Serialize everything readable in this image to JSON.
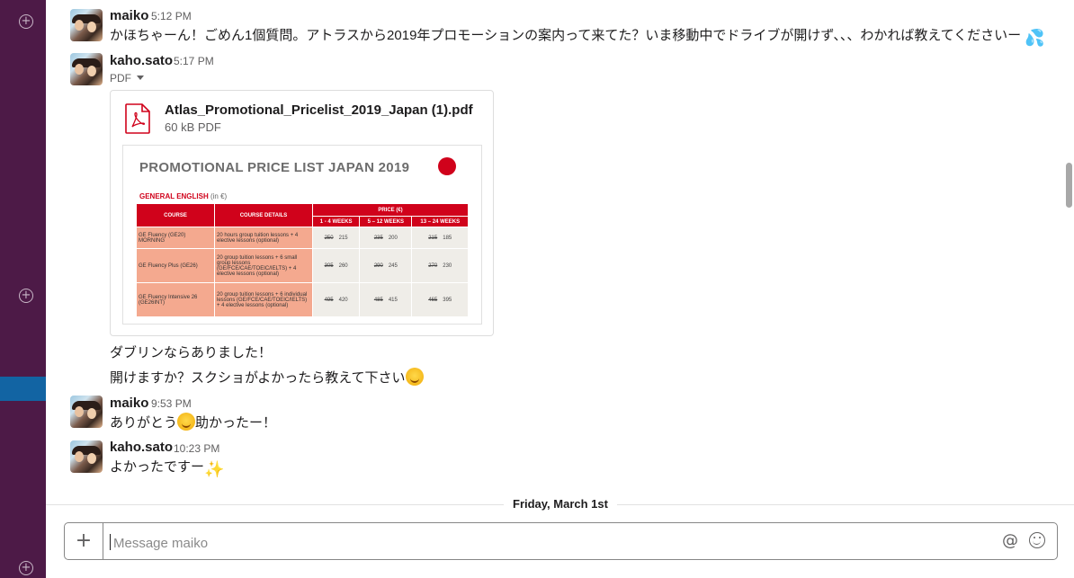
{
  "messages": [
    {
      "author": "maiko",
      "time": "5:12 PM",
      "text": "かほちゃーん！ごめん1個質問。アトラスから2019年プロモーションの案内って来てた？いま移動中でドライブが開けず、、、わかれば教えてくださいー"
    },
    {
      "author": "kaho.sato",
      "time": "5:17 PM",
      "attachment_type": "PDF",
      "file": {
        "name": "Atlas_Promotional_Pricelist_2019_Japan (1).pdf",
        "meta": "60 kB PDF"
      },
      "followups": [
        "ダブリンならありました！",
        "開けますか？スクショがよかったら教えて下さい"
      ]
    },
    {
      "author": "maiko",
      "time": "9:53 PM",
      "text_before": "ありがとう",
      "text_after": "助かったー！"
    },
    {
      "author": "kaho.sato",
      "time": "10:23 PM",
      "text": "よかったですー"
    }
  ],
  "preview": {
    "title": "PROMOTIONAL PRICE LIST JAPAN 2019",
    "section": "GENERAL ENGLISH",
    "section_unit": "(in €)",
    "headers": {
      "course": "COURSE",
      "details": "COURSE DETAILS",
      "price": "PRICE (€)",
      "w1": "1 - 4 WEEKS",
      "w2": "5 – 12 WEEKS",
      "w3": "13 – 24 WEEKS"
    },
    "rows": [
      {
        "course": "GE Fluency (GE20) MORNING",
        "details": "20 hours group tuition lessons + 4 elective lessons (optional)",
        "p1o": "250",
        "p1": "215",
        "p2o": "235",
        "p2": "200",
        "p3o": "215",
        "p3": "185"
      },
      {
        "course": "GE Fluency Plus (GE26)",
        "details": "20 group tuition lessons + 6 small group lessons (GE/FCE/CAE/TOEIC/IELTS) + 4 elective lessons (optional)",
        "p1o": "305",
        "p1": "260",
        "p2o": "290",
        "p2": "245",
        "p3o": "270",
        "p3": "230"
      },
      {
        "course": "GE Fluency Intensive 26 (GE26INT)",
        "details": "20 group tuition lessons + 6 individual lessons (GE/FCE/CAE/TOEIC/IELTS) + 4 elective lessons (optional)",
        "p1o": "495",
        "p1": "420",
        "p2o": "485",
        "p2": "415",
        "p3o": "465",
        "p3": "395"
      }
    ]
  },
  "divider": {
    "date": "Friday, March 1st"
  },
  "composer": {
    "placeholder": "Message maiko"
  },
  "icons": {
    "emoji1": "sweat-droplets-icon",
    "emoji2": "smiling-face-icon",
    "emoji3": "sparkles-icon"
  },
  "colors": {
    "sidebar": "#4d1a47",
    "accent": "#1264a3",
    "pdf_red": "#d0021b"
  }
}
